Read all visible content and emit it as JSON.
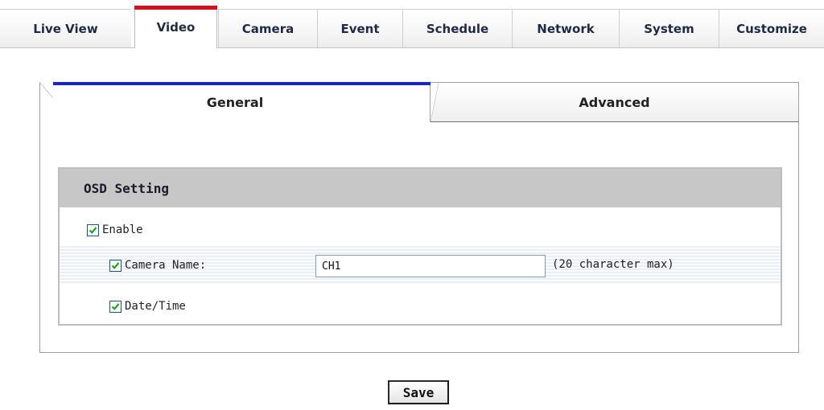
{
  "top_tabs": {
    "items": [
      {
        "label": "Live View"
      },
      {
        "label": "Video"
      },
      {
        "label": "Camera"
      },
      {
        "label": "Event"
      },
      {
        "label": "Schedule"
      },
      {
        "label": "Network"
      },
      {
        "label": "System"
      },
      {
        "label": "Customize"
      }
    ],
    "active": "Video",
    "active_accent": "#d8101c"
  },
  "sub_tabs": {
    "general": "General",
    "advanced": "Advanced",
    "active": "General",
    "active_accent": "#1a25c9"
  },
  "osd": {
    "title": "OSD Setting",
    "enable": {
      "label": "Enable",
      "checked": true
    },
    "camera_name": {
      "label": "Camera Name:",
      "checked": true,
      "value": "CH1",
      "hint": "(20 character max)"
    },
    "date_time": {
      "label": "Date/Time",
      "checked": true
    }
  },
  "save_label": "Save"
}
